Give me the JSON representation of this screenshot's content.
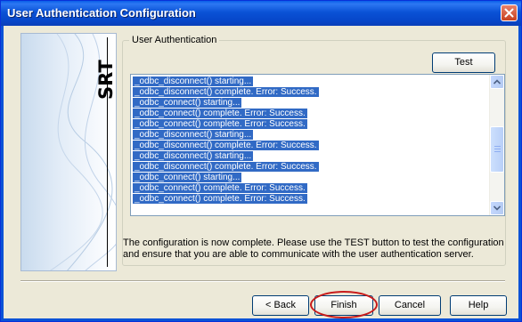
{
  "window": {
    "title": "User Authentication Configuration"
  },
  "banner": {
    "text": "SRT"
  },
  "group": {
    "label": "User Authentication",
    "test_label": "Test"
  },
  "log": {
    "lines": [
      "_odbc_disconnect() starting...",
      "_odbc_disconnect() complete. Error: Success.",
      "_odbc_connect() starting...",
      "_odbc_connect() complete. Error: Success.",
      "_odbc_connect() complete. Error: Success.",
      "_odbc_disconnect() starting...",
      "_odbc_disconnect() complete. Error: Success.",
      "_odbc_disconnect() starting...",
      "_odbc_disconnect() complete. Error: Success.",
      "_odbc_connect() starting...",
      "_odbc_connect() complete. Error: Success.",
      "_odbc_connect() complete. Error: Success."
    ],
    "selected": true
  },
  "description": "The configuration is now complete. Please use the TEST button to test the configuration and ensure that you are able to communicate with the user authentication server.",
  "buttons": {
    "back": "< Back",
    "finish": "Finish",
    "cancel": "Cancel",
    "help": "Help"
  },
  "annotation": {
    "highlight_color": "#c81a1a",
    "target": "Finish"
  },
  "colors": {
    "titlebar": "#0a52d6",
    "selection": "#316ac5",
    "dialog_bg": "#ece9d8"
  },
  "icons": {
    "close": "close-icon",
    "scroll_up": "chevron-up-icon",
    "scroll_down": "chevron-down-icon"
  }
}
